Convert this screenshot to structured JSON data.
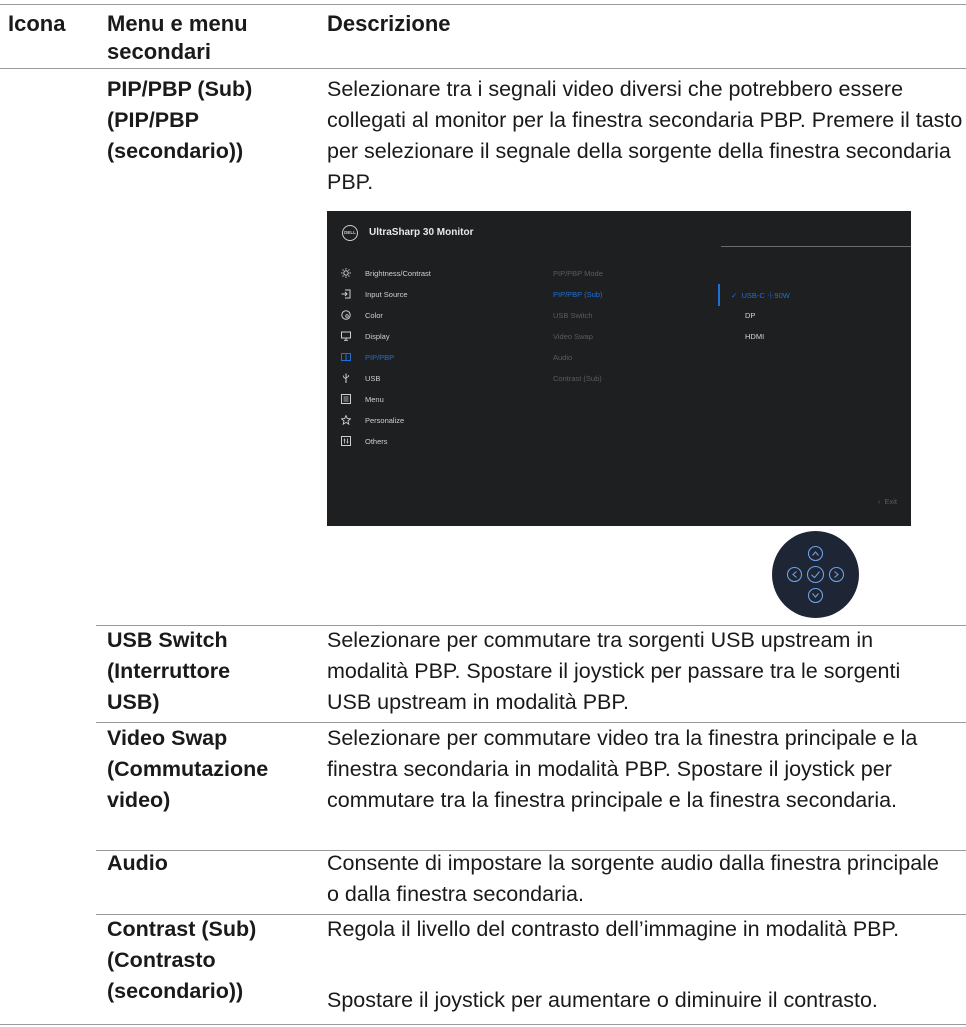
{
  "header": {
    "col_icon": "Icona",
    "col_menu": "Menu e menu secondari",
    "col_desc": "Descrizione"
  },
  "rows": [
    {
      "menu": "PIP/PBP (Sub) (PIP/PBP (secondario))",
      "desc": "Selezionare tra i segnali video diversi che potrebbero essere collegati al monitor per la finestra secondaria PBP. Premere il tasto    per selezionare il segnale della sorgente della finestra secondaria PBP."
    },
    {
      "menu": "USB Switch (Interruttore USB)",
      "desc": "Selezionare per commutare tra sorgenti USB upstream in modalità PBP. Spostare il joystick per passare tra le sorgenti USB upstream in modalità PBP."
    },
    {
      "menu": "Video Swap (Commutazione video)",
      "desc": "Selezionare per commutare video tra la finestra principale e la finestra secondaria in modalità PBP. Spostare il joystick per commutare tra la finestra principale e la finestra secondaria."
    },
    {
      "menu": "Audio",
      "desc": "Consente di impostare la sorgente audio dalla finestra principale o dalla finestra secondaria."
    },
    {
      "menu": "Contrast (Sub) (Contrasto (secondario))",
      "desc": "Regola il livello del contrasto dell’immagine in modalità PBP.",
      "desc2": "Spostare il joystick per aumentare o diminuire il contrasto."
    }
  ],
  "osd": {
    "logo": "DELL",
    "title": "UltraSharp 30 Monitor",
    "menu_items": [
      {
        "label": "Brightness/Contrast",
        "icon": "brightness-icon"
      },
      {
        "label": "Input Source",
        "icon": "input-source-icon"
      },
      {
        "label": "Color",
        "icon": "color-icon"
      },
      {
        "label": "Display",
        "icon": "display-icon"
      },
      {
        "label": "PIP/PBP",
        "icon": "pip-pbp-icon",
        "active": true
      },
      {
        "label": "USB",
        "icon": "usb-icon"
      },
      {
        "label": "Menu",
        "icon": "menu-icon"
      },
      {
        "label": "Personalize",
        "icon": "star-icon"
      },
      {
        "label": "Others",
        "icon": "others-icon"
      }
    ],
    "submenu": [
      "PIP/PBP Mode",
      "PIP/PBP (Sub)",
      "USB Switch",
      "Video Swap",
      "Audio",
      "Contrast (Sub)"
    ],
    "submenu_active": "PIP/PBP (Sub)",
    "options": [
      {
        "label": "USB-C",
        "extra": "90W",
        "selected": true
      },
      {
        "label": "DP"
      },
      {
        "label": "HDMI"
      }
    ],
    "exit": "Exit",
    "accent": "#1f6fd6"
  },
  "joystick": {
    "icon": "joystick-icon"
  }
}
